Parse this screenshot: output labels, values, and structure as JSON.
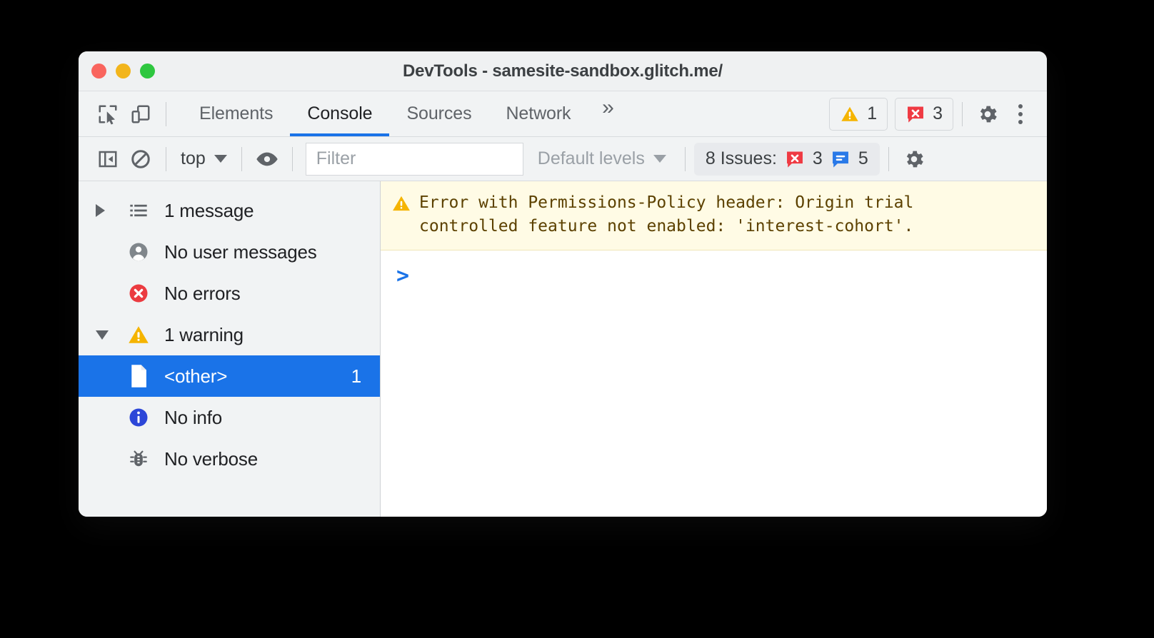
{
  "window": {
    "title": "DevTools - samesite-sandbox.glitch.me/",
    "traffic_lights": [
      {
        "name": "close",
        "color": "#f9655e"
      },
      {
        "name": "minimize",
        "color": "#f2b51c"
      },
      {
        "name": "zoom",
        "color": "#2ec73f"
      }
    ]
  },
  "tabbar": {
    "inspect_icon": "inspect-element-icon",
    "device_icon": "device-toolbar-icon",
    "tabs": [
      {
        "label": "Elements",
        "active": false
      },
      {
        "label": "Console",
        "active": true
      },
      {
        "label": "Sources",
        "active": false
      },
      {
        "label": "Network",
        "active": false
      }
    ],
    "overflow_label": "»",
    "warning_count": "1",
    "error_count": "3",
    "settings_icon": "gear-icon",
    "more_icon": "kebab-menu-icon"
  },
  "consolebar": {
    "sidebar_toggle_icon": "console-sidebar-toggle-icon",
    "clear_icon": "clear-console-icon",
    "context_label": "top",
    "eye_icon": "live-expression-icon",
    "filter_placeholder": "Filter",
    "filter_value": "",
    "levels_label": "Default levels",
    "issues_label": "8 Issues:",
    "issues_error_count": "3",
    "issues_info_count": "5",
    "settings_icon": "gear-icon"
  },
  "sidebar": {
    "items": [
      {
        "name": "messages",
        "twisty": "right",
        "icon": "list-icon",
        "label": "1 message",
        "count": "",
        "selected": false
      },
      {
        "name": "user-messages",
        "twisty": "none",
        "icon": "user-icon",
        "label": "No user messages",
        "count": "",
        "selected": false
      },
      {
        "name": "errors",
        "twisty": "none",
        "icon": "error-icon",
        "label": "No errors",
        "count": "",
        "selected": false
      },
      {
        "name": "warnings",
        "twisty": "down",
        "icon": "warning-icon",
        "label": "1 warning",
        "count": "",
        "selected": false
      },
      {
        "name": "other",
        "twisty": "none",
        "icon": "file-icon",
        "label": "<other>",
        "count": "1",
        "selected": true
      },
      {
        "name": "info",
        "twisty": "none",
        "icon": "info-icon",
        "label": "No info",
        "count": "",
        "selected": false
      },
      {
        "name": "verbose",
        "twisty": "none",
        "icon": "bug-icon",
        "label": "No verbose",
        "count": "",
        "selected": false
      }
    ]
  },
  "console": {
    "messages": [
      {
        "level": "warning",
        "icon": "warning-icon",
        "text": "Error with Permissions-Policy header: Origin trial\ncontrolled feature not enabled: 'interest-cohort'."
      }
    ],
    "prompt_symbol": ">",
    "prompt_value": ""
  },
  "colors": {
    "accent": "#1a73e8",
    "warning": "#f5b400",
    "error": "#ef3a43",
    "info": "#1a56db",
    "warn_bg": "#fffbe5",
    "warn_text": "#5c4100"
  }
}
